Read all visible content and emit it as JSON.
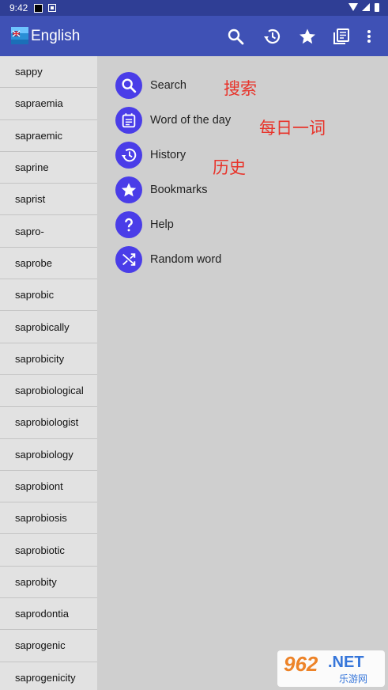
{
  "status_bar": {
    "time": "9:42"
  },
  "app_bar": {
    "title": "English",
    "actions": [
      "search-icon",
      "history-icon",
      "star-icon",
      "library-icon",
      "more-vert-icon"
    ]
  },
  "sidebar": {
    "words": [
      "sappy",
      "sapraemia",
      "sapraemic",
      "saprine",
      "saprist",
      "sapro-",
      "saprobe",
      "saprobic",
      "saprobically",
      "saprobicity",
      "saprobiological",
      "saprobiologist",
      "saprobiology",
      "saprobiont",
      "saprobiosis",
      "saprobiotic",
      "saprobity",
      "saprodontia",
      "saprogenic",
      "saprogenicity"
    ]
  },
  "menu": {
    "items": [
      {
        "label": "Search",
        "icon": "search-icon"
      },
      {
        "label": "Word of the day",
        "icon": "calendar-icon"
      },
      {
        "label": "History",
        "icon": "history-icon"
      },
      {
        "label": "Bookmarks",
        "icon": "star-icon"
      },
      {
        "label": "Help",
        "icon": "help-icon"
      },
      {
        "label": "Random word",
        "icon": "shuffle-icon"
      }
    ]
  },
  "annotations": {
    "search": "搜索",
    "word_of_day": "每日一词",
    "history": "历史"
  },
  "watermark": {
    "big": "962",
    "net": ".NET",
    "small": "乐游网"
  },
  "colors": {
    "status_bar": "#2f3e95",
    "app_bar": "#3f51b5",
    "accent": "#4a3de8",
    "annotation": "#e8332a"
  }
}
